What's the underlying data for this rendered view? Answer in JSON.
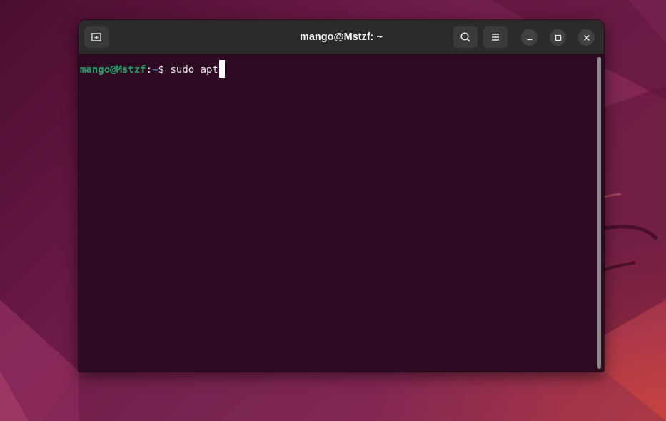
{
  "window": {
    "title": "mango@Mstzf: ~"
  },
  "toolbar": {
    "new_tab_icon": "new-tab-icon",
    "search_icon": "search-icon",
    "menu_icon": "hamburger-menu-icon"
  },
  "window_controls": {
    "minimize_icon": "minimize-icon",
    "maximize_icon": "maximize-icon",
    "close_icon": "close-icon"
  },
  "terminal": {
    "prompt_user": "mango@Mstzf",
    "prompt_separator": ":",
    "prompt_path": "~",
    "prompt_symbol": "$",
    "command": " sudo apt"
  },
  "colors": {
    "terminal_background": "#2c0a21",
    "prompt_user": "#26a269",
    "prompt_path": "#3e7ad1",
    "titlebar": "#2b2b2b"
  }
}
